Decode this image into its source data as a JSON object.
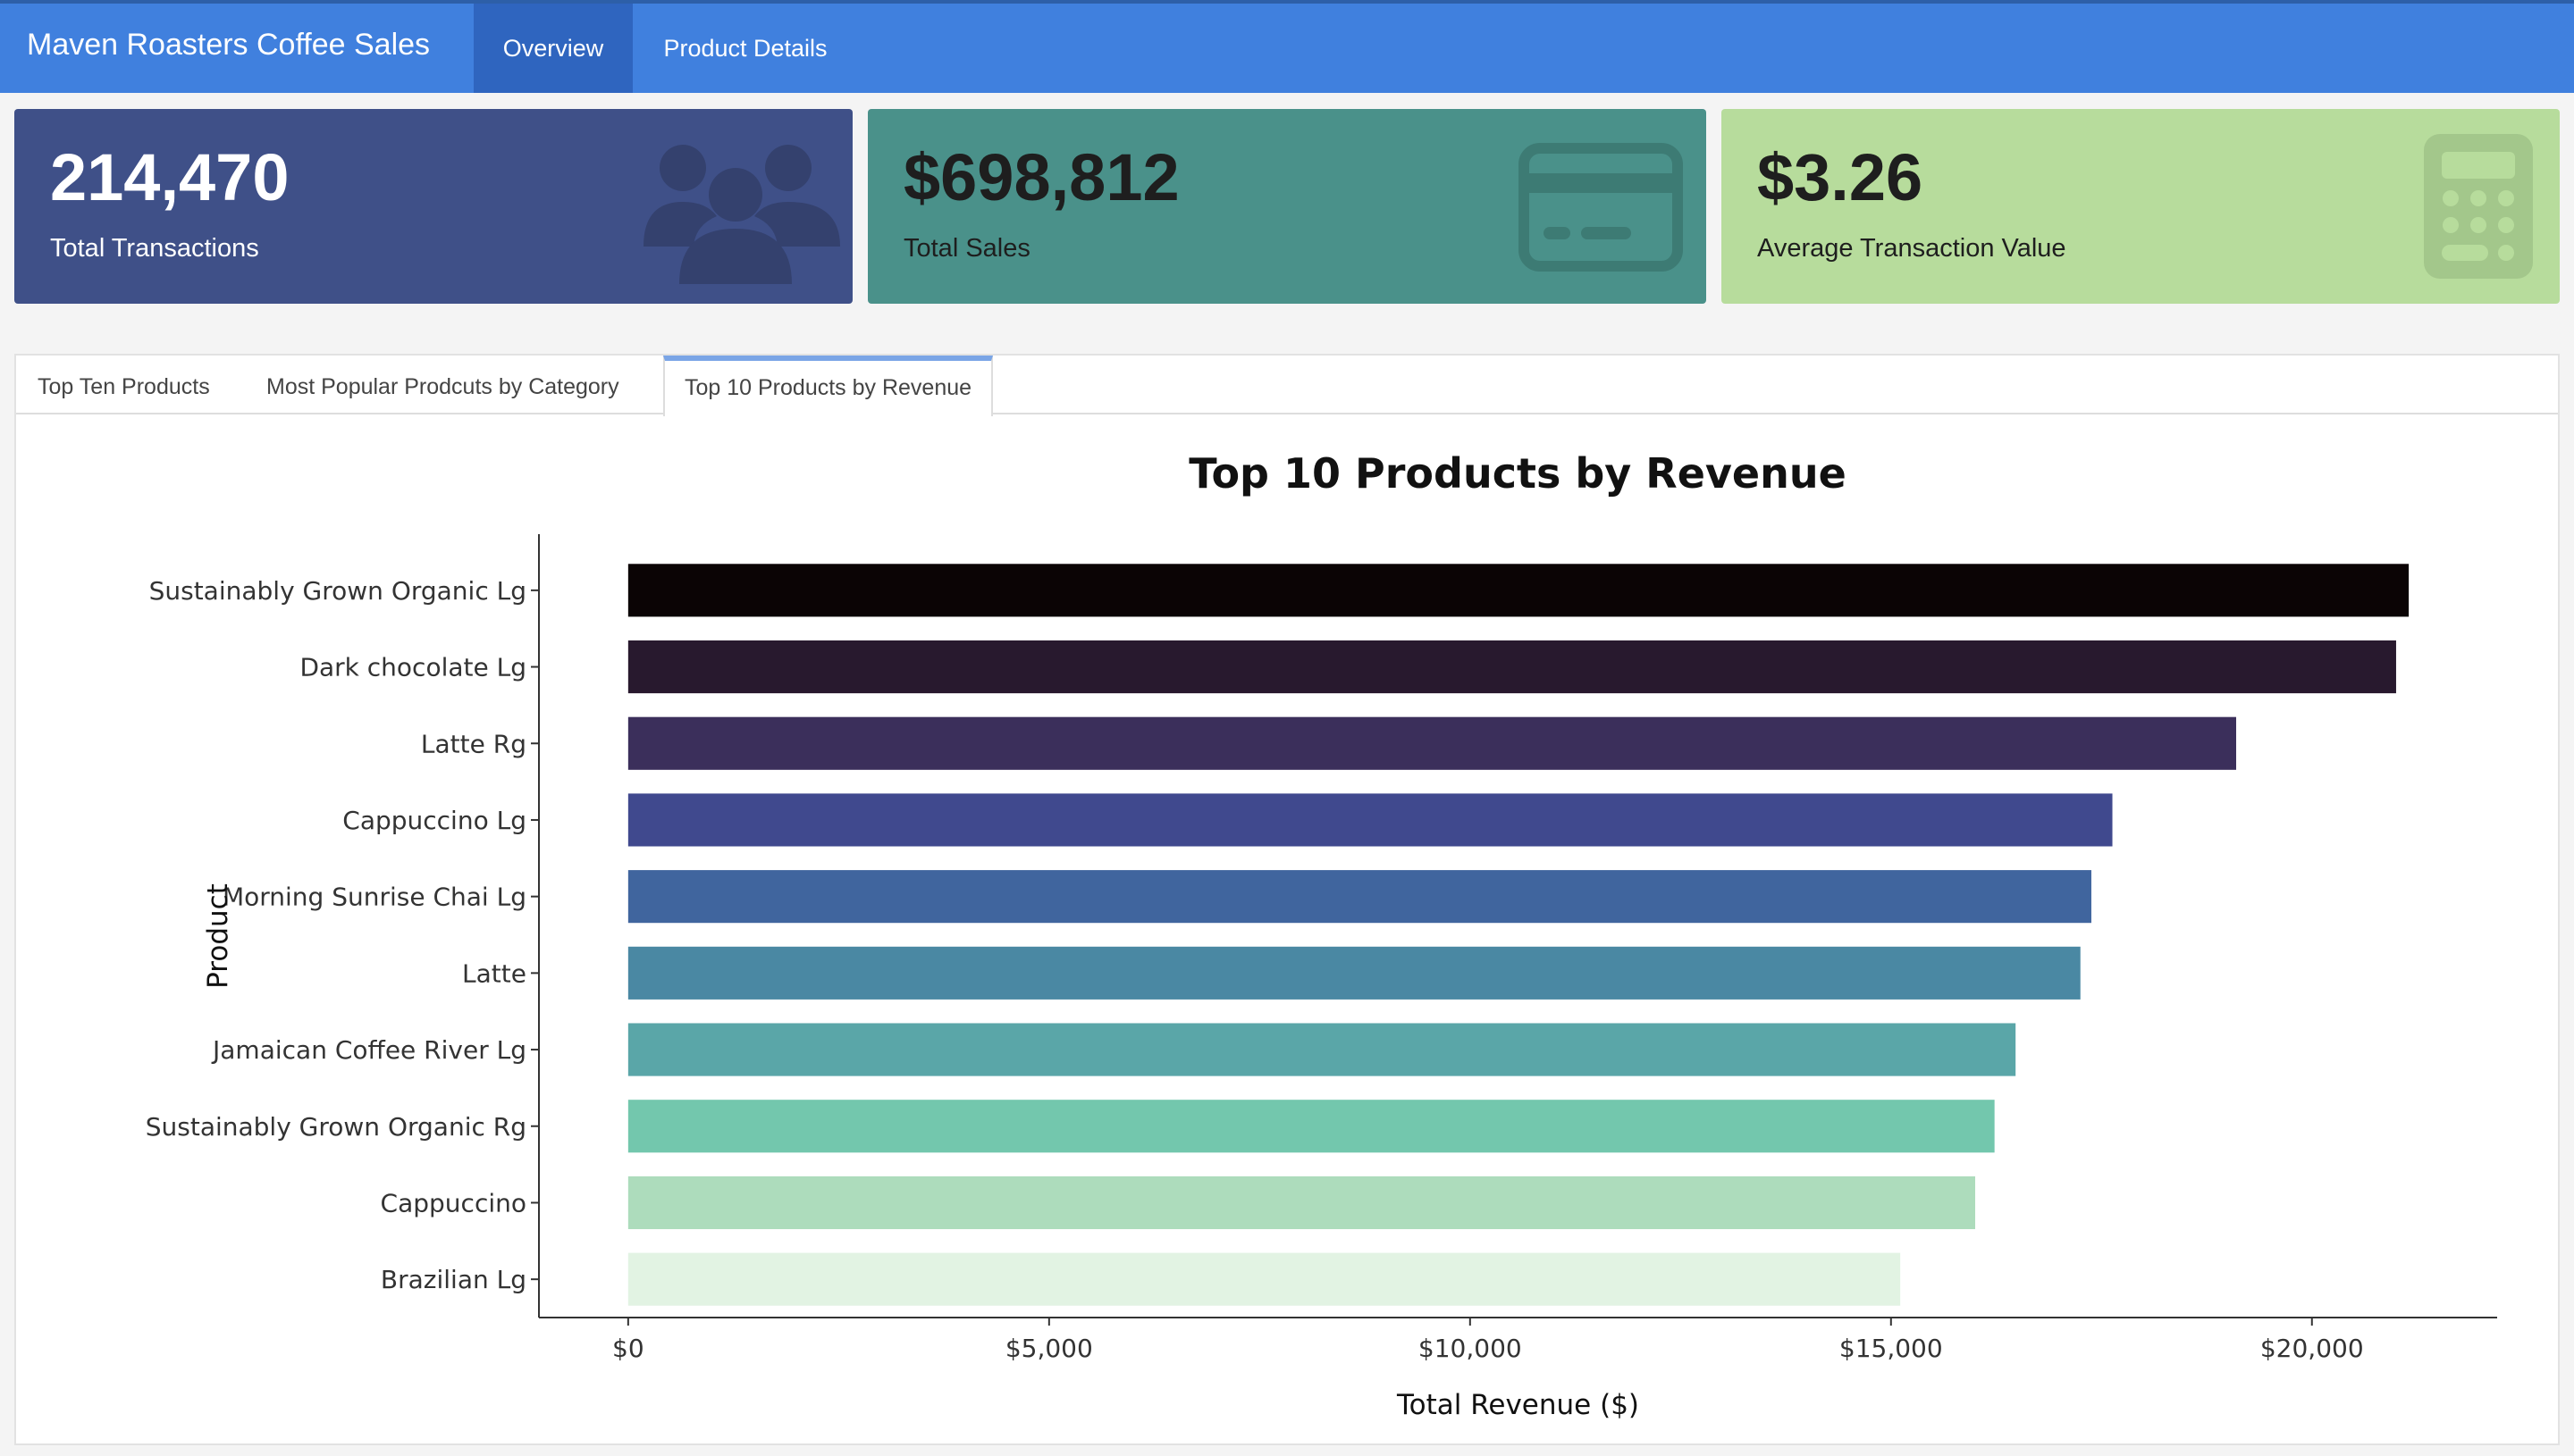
{
  "header": {
    "title": "Maven Roasters Coffee Sales",
    "tabs": [
      {
        "label": "Overview",
        "active": true
      },
      {
        "label": "Product Details",
        "active": false
      }
    ]
  },
  "cards": [
    {
      "value": "214,470",
      "label": "Total Transactions",
      "color": "#3f5088",
      "text_color": "#ffffff",
      "icon": "users-icon"
    },
    {
      "value": "$698,812",
      "label": "Total Sales",
      "color": "#4a918a",
      "text_color": "#1e1e1e",
      "icon": "credit-card-icon"
    },
    {
      "value": "$3.26",
      "label": "Average Transaction Value",
      "color": "#b7dc9c",
      "text_color": "#1e1e1e",
      "icon": "calculator-icon"
    }
  ],
  "sub_tabs": [
    {
      "label": "Top Ten Products",
      "active": false
    },
    {
      "label": "Most Popular Prodcuts by Category",
      "active": false
    },
    {
      "label": "Top 10 Products by Revenue",
      "active": true
    }
  ],
  "chart_data": {
    "type": "bar",
    "orientation": "horizontal",
    "title": "Top 10 Products by Revenue",
    "xlabel": "Total Revenue ($)",
    "ylabel": "Product",
    "categories": [
      "Sustainably Grown Organic Lg",
      "Dark chocolate Lg",
      "Latte Rg",
      "Cappuccino Lg",
      "Morning Sunrise Chai Lg",
      "Latte",
      "Jamaican Coffee River Lg",
      "Sustainably Grown Organic Rg",
      "Cappuccino",
      "Brazilian Lg"
    ],
    "values": [
      21150,
      21000,
      19100,
      17630,
      17380,
      17250,
      16480,
      16230,
      16000,
      15110
    ],
    "colors": [
      "#0b0405",
      "#28192e",
      "#3b2f5b",
      "#40498e",
      "#40659e",
      "#4a88a3",
      "#5aa6a8",
      "#73c7ad",
      "#addcbc",
      "#e2f3e3"
    ],
    "xlim": [
      -1060,
      22200
    ],
    "xticks": [
      0,
      5000,
      10000,
      15000,
      20000
    ],
    "xtick_labels": [
      "$0",
      "$5,000",
      "$10,000",
      "$15,000",
      "$20,000"
    ],
    "grid": false,
    "legend": "none"
  }
}
